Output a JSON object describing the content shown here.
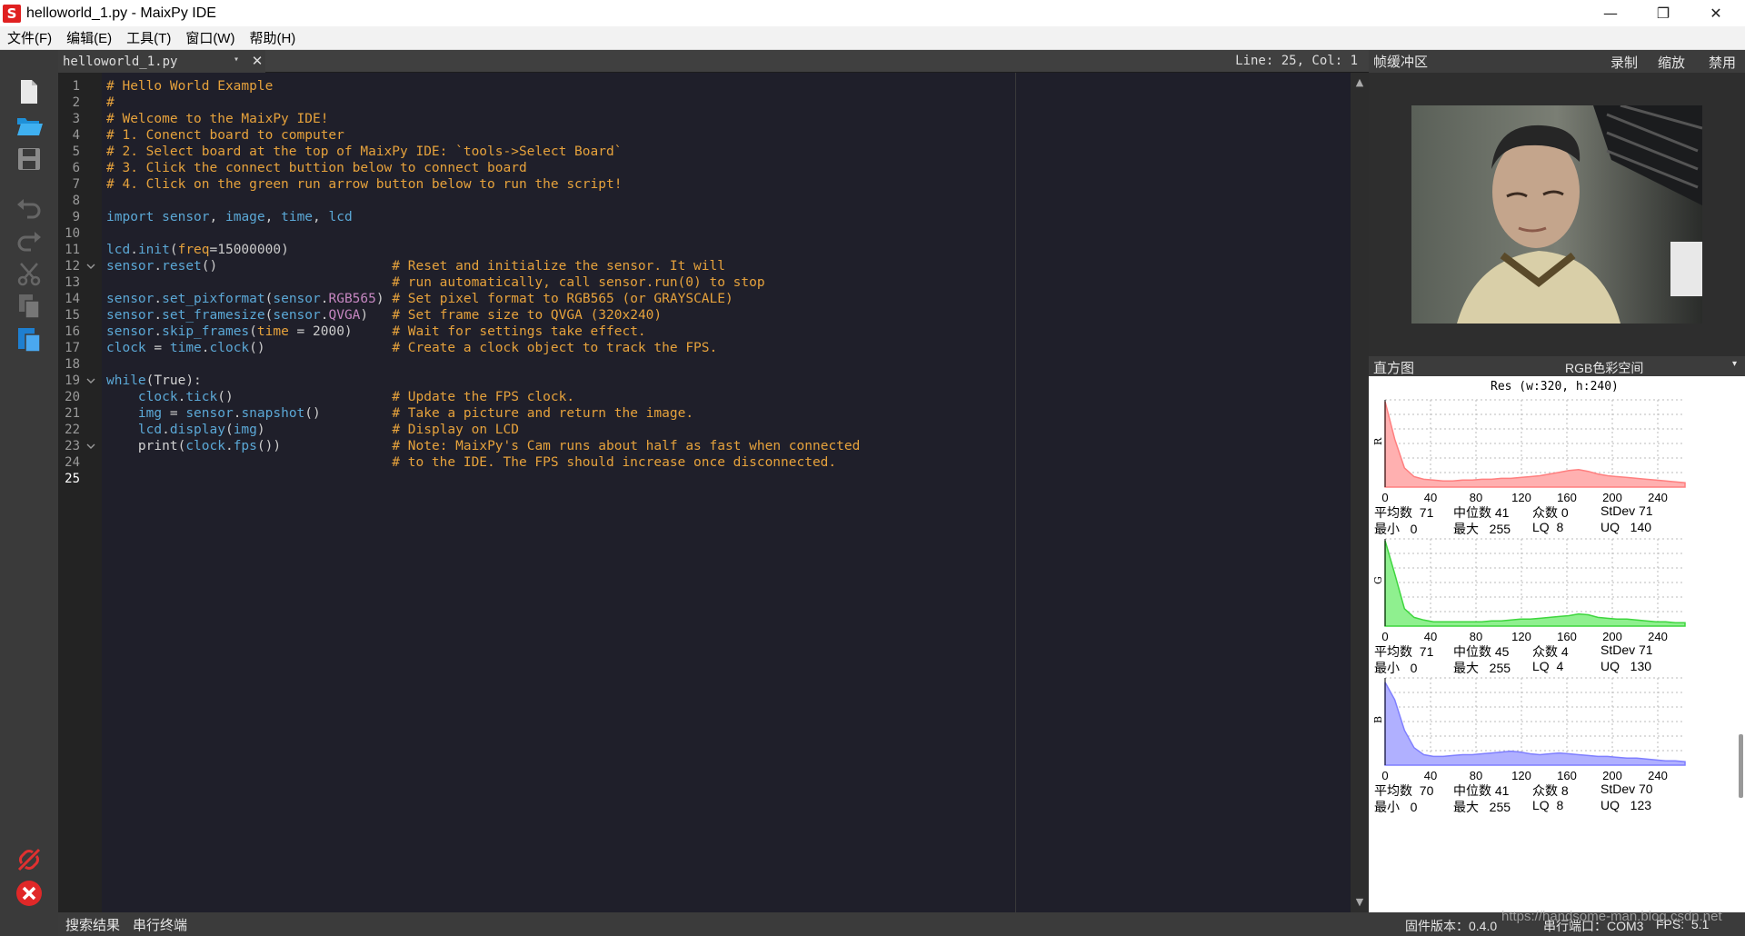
{
  "window": {
    "title": "helloworld_1.py - MaixPy IDE",
    "logo_letter": "S",
    "minimize": "—",
    "maximize": "❐",
    "close": "✕"
  },
  "menu": {
    "items": [
      "文件(F)",
      "编辑(E)",
      "工具(T)",
      "窗口(W)",
      "帮助(H)"
    ]
  },
  "toolbar": {
    "icons": [
      "new-file-icon",
      "open-folder-icon",
      "save-icon",
      "undo-icon",
      "redo-icon",
      "cut-icon",
      "copy-icon",
      "paste-icon",
      "disconnect-icon",
      "stop-icon"
    ]
  },
  "editor": {
    "tab_label": "helloworld_1.py",
    "tab_dropdown": "▾",
    "tab_close": "✕",
    "cursor_position": "Line: 25, Col: 1",
    "current_line": 25,
    "line_numbers": [
      "1",
      "2",
      "3",
      "4",
      "5",
      "6",
      "7",
      "8",
      "9",
      "10",
      "11",
      "12",
      "13",
      "14",
      "15",
      "16",
      "17",
      "18",
      "19",
      "20",
      "21",
      "22",
      "23",
      "24",
      "25"
    ],
    "code_lines": [
      "# Hello World Example",
      "#",
      "# Welcome to the MaixPy IDE!",
      "# 1. Conenct board to computer",
      "# 2. Select board at the top of MaixPy IDE: `tools->Select Board`",
      "# 3. Click the connect buttion below to connect board",
      "# 4. Click on the green run arrow button below to run the script!",
      "",
      "import sensor, image, time, lcd",
      "",
      "lcd.init(freq=15000000)",
      "sensor.reset()                      # Reset and initialize the sensor. It will",
      "                                    # run automatically, call sensor.run(0) to stop",
      "sensor.set_pixformat(sensor.RGB565) # Set pixel format to RGB565 (or GRAYSCALE)",
      "sensor.set_framesize(sensor.QVGA)   # Set frame size to QVGA (320x240)",
      "sensor.skip_frames(time = 2000)     # Wait for settings take effect.",
      "clock = time.clock()                # Create a clock object to track the FPS.",
      "",
      "while(True):",
      "    clock.tick()                    # Update the FPS clock.",
      "    img = sensor.snapshot()         # Take a picture and return the image.",
      "    lcd.display(img)                # Display on LCD",
      "    print(clock.fps())              # Note: MaixPy's Cam runs about half as fast when connected",
      "                                    # to the IDE. The FPS should increase once disconnected.",
      ""
    ]
  },
  "bottom_tabs": [
    "搜索结果",
    "串行终端"
  ],
  "framebuffer": {
    "title": "帧缓冲区",
    "record": "录制",
    "zoom": "缩放",
    "disable": "禁用"
  },
  "histogram": {
    "title": "直方图",
    "colorspace": "RGB色彩空间",
    "dropdown": "▾",
    "resolution": "Res (w:320, h:240)",
    "x_ticks": [
      "0",
      "40",
      "80",
      "120",
      "160",
      "200",
      "240"
    ],
    "stat_labels": {
      "mean": "平均数",
      "median": "中位数",
      "mode": "众数",
      "stdev": "StDev",
      "min": "最小",
      "max": "最大",
      "lq": "LQ",
      "uq": "UQ"
    },
    "channels": [
      {
        "name": "R",
        "color": "#ff7f7f",
        "fill": "#ffb0b0",
        "mean": "71",
        "median": "41",
        "mode": "0",
        "stdev": "71",
        "min": "0",
        "max": "255",
        "lq": "8",
        "uq": "140",
        "profile": [
          0.98,
          0.55,
          0.22,
          0.12,
          0.09,
          0.08,
          0.07,
          0.07,
          0.08,
          0.08,
          0.09,
          0.09,
          0.1,
          0.1,
          0.11,
          0.12,
          0.13,
          0.15,
          0.17,
          0.19,
          0.2,
          0.18,
          0.15,
          0.13,
          0.12,
          0.11,
          0.1,
          0.09,
          0.08,
          0.07,
          0.06,
          0.05
        ]
      },
      {
        "name": "G",
        "color": "#3ed63e",
        "fill": "#8ff08f",
        "mean": "71",
        "median": "45",
        "mode": "4",
        "stdev": "71",
        "min": "0",
        "max": "255",
        "lq": "4",
        "uq": "130",
        "profile": [
          0.98,
          0.6,
          0.2,
          0.1,
          0.07,
          0.05,
          0.05,
          0.05,
          0.05,
          0.05,
          0.05,
          0.06,
          0.06,
          0.07,
          0.08,
          0.08,
          0.09,
          0.1,
          0.11,
          0.12,
          0.14,
          0.13,
          0.1,
          0.09,
          0.08,
          0.08,
          0.07,
          0.06,
          0.05,
          0.05,
          0.04,
          0.04
        ]
      },
      {
        "name": "B",
        "color": "#7f7fff",
        "fill": "#b0b0ff",
        "mean": "70",
        "median": "41",
        "mode": "8",
        "stdev": "70",
        "min": "0",
        "max": "255",
        "lq": "8",
        "uq": "123",
        "profile": [
          0.95,
          0.75,
          0.4,
          0.2,
          0.12,
          0.1,
          0.1,
          0.11,
          0.12,
          0.12,
          0.13,
          0.14,
          0.15,
          0.16,
          0.15,
          0.13,
          0.12,
          0.13,
          0.14,
          0.13,
          0.12,
          0.11,
          0.1,
          0.1,
          0.09,
          0.08,
          0.08,
          0.07,
          0.06,
          0.05,
          0.05,
          0.04
        ]
      }
    ]
  },
  "status": {
    "firmware": "固件版本：0.4.0",
    "serial": "串行端口：COM3",
    "fps": "FPS:  5.1"
  },
  "watermark": "https://handsome-man.blog.csdn.net"
}
